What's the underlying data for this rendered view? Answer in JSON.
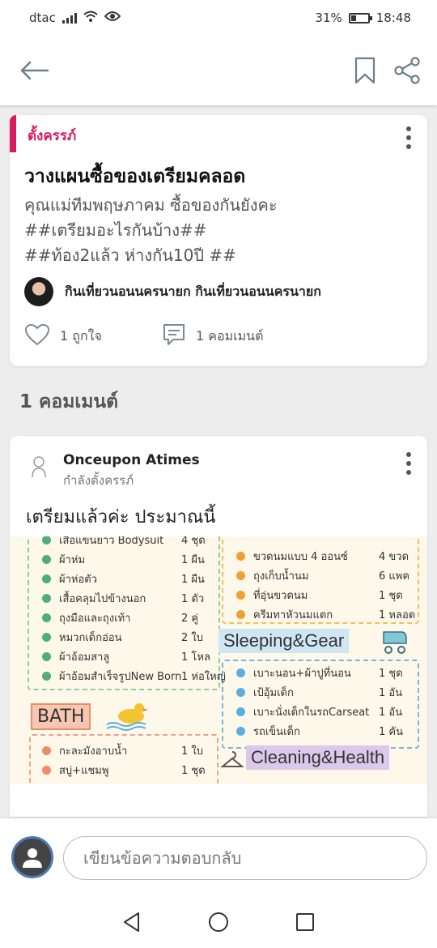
{
  "status": {
    "carrier": "dtac",
    "battery": "31%",
    "battery_level": 0.31,
    "time": "18:48"
  },
  "topbar": {
    "back_icon": "arrow-left-icon",
    "bookmark_icon": "bookmark-icon",
    "share_icon": "share-icon"
  },
  "post": {
    "category": "ตั้งครรภ์",
    "title": "วางแผนซื้อของเตรียมคลอด",
    "body_lines": [
      "คุณแม่ทีมพฤษภาคม ซื้อของกันยังคะ",
      "##เตรียมอะไรกันบ้าง##",
      "##ท้อง2แล้ว ห่างกัน10ปี ##"
    ],
    "author": "กินเที่ยวนอนนครนายก กินเที่ยวนอนนครนายก",
    "likes_label": "1 ถูกใจ",
    "comments_label": "1 คอมเมนต์"
  },
  "comments_header": "1 คอมเมนต์",
  "comment": {
    "author": "Onceupon Atimes",
    "status": "กำลังตั้งครรภ์",
    "text": "เตรียมแล้วค่ะ ประมาณนี้",
    "image": {
      "left_items": [
        {
          "label": "เสื้อแขนยาว Bodysuit",
          "qty": "4 ชุด"
        },
        {
          "label": "ผ้าห่ม",
          "qty": "1 ผืน"
        },
        {
          "label": "ผ้าห่อตัว",
          "qty": "1 ผืน"
        },
        {
          "label": "เสื้อคลุมไปข้างนอก",
          "qty": "1 ตัว"
        },
        {
          "label": "ถุงมือและถุงเท้า",
          "qty": "2 คู่"
        },
        {
          "label": "หมวกเด็กอ่อน",
          "qty": "2 ใบ"
        },
        {
          "label": "ผ้าอ้อมสาลู",
          "qty": "1 โหล"
        },
        {
          "label": "ผ้าอ้อมสำเร็จรูปNew Born",
          "qty": "1 ห่อใหญ่"
        }
      ],
      "bath_title": "BATH",
      "bath_items": [
        {
          "label": "กะละมังอาบน้ำ",
          "qty": "1 ใบ"
        },
        {
          "label": "สบู่+แชมพู",
          "qty": "1 ชุด"
        }
      ],
      "feeding_items": [
        {
          "label": "ขวดนมแบบ 4 ออนซ์",
          "qty": "4 ขวด"
        },
        {
          "label": "ถุงเก็บน้ำนม",
          "qty": "6 แพค"
        },
        {
          "label": "ที่อุ่นขวดนม",
          "qty": "1 ชุด"
        },
        {
          "label": "ครีมทาหัวนมแตก",
          "qty": "1 หลอด"
        }
      ],
      "sleeping_title": "Sleeping&Gear",
      "sleeping_items": [
        {
          "label": "เบาะนอน+ผ้าปูที่นอน",
          "qty": "1 ชุด"
        },
        {
          "label": "เป้อุ้มเด็ก",
          "qty": "1 อัน"
        },
        {
          "label": "เบาะนั่งเด็กในรถCarseat",
          "qty": "1 อัน"
        },
        {
          "label": "รถเข็นเด็ก",
          "qty": "1 คัน"
        }
      ],
      "cleaning_title": "Cleaning&Health"
    }
  },
  "reply": {
    "placeholder": "เขียนข้อความตอบกลับ"
  },
  "colors": {
    "accent": "#d81b60",
    "green": "#4caf73",
    "orange": "#f0a030",
    "blue": "#5aaee0",
    "salmon": "#f08a6a"
  }
}
